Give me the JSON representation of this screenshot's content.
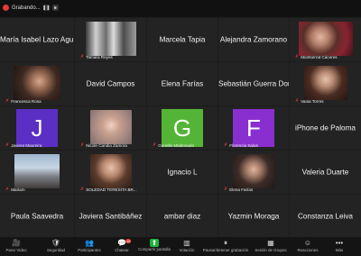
{
  "recording": {
    "label": "Grabando..."
  },
  "tiles": [
    {
      "name": "María Isabel Lazo Agu...",
      "label": ""
    },
    {
      "name": "",
      "label": "Tamara Reyes"
    },
    {
      "name": "Marcela Tapia",
      "label": ""
    },
    {
      "name": "Alejandra Zamorano",
      "label": ""
    },
    {
      "name": "",
      "label": "Montserrat Cáceres"
    },
    {
      "name": "",
      "label": "Francesca Rosa"
    },
    {
      "name": "David Campos",
      "label": ""
    },
    {
      "name": "Elena Farías",
      "label": ""
    },
    {
      "name": "Sebastián Guerra Don...",
      "label": ""
    },
    {
      "name": "",
      "label": "Vania Torres"
    },
    {
      "name": "",
      "initial": "J",
      "label": "Javiera Maureira"
    },
    {
      "name": "",
      "label": "Nicole Candia Zamora"
    },
    {
      "name": "",
      "initial": "G",
      "label": "Gunelle Maldonado"
    },
    {
      "name": "",
      "initial": "F",
      "label": "Florencia Salas"
    },
    {
      "name": "iPhone de Paloma",
      "label": ""
    },
    {
      "name": "",
      "label": "Mariam"
    },
    {
      "name": "",
      "label": "SOLEDAD TERESITA BR..."
    },
    {
      "name": "Ignacio L",
      "label": ""
    },
    {
      "name": "",
      "label": "Elena Farías"
    },
    {
      "name": "Valeria Duarte",
      "label": ""
    },
    {
      "name": "Paula Saavedra",
      "label": ""
    },
    {
      "name": "Javiera Santibáñez",
      "label": ""
    },
    {
      "name": "ambar diaz",
      "label": ""
    },
    {
      "name": "Yazmin Moraga",
      "label": ""
    },
    {
      "name": "Constanza Leiva",
      "label": ""
    }
  ],
  "toolbar": {
    "items": [
      {
        "label": "Parar Video",
        "icon": "🎥"
      },
      {
        "label": "Seguridad",
        "icon": "🛡"
      },
      {
        "label": "Participantes",
        "icon": "👥"
      },
      {
        "label": "Chatear",
        "icon": "💬",
        "badge": "19"
      },
      {
        "label": "Compartir pantalla",
        "icon": "⬆"
      },
      {
        "label": "Votación",
        "icon": "▥"
      },
      {
        "label": "Pausar/detener grabación",
        "icon": "⏸"
      },
      {
        "label": "Sesión de Grupos",
        "icon": "▦"
      },
      {
        "label": "Reacciones",
        "icon": "☺"
      },
      {
        "label": "Más",
        "icon": "•••"
      }
    ]
  },
  "colors": {
    "avatar_j": "#5b2fc4",
    "avatar_g": "#54b435",
    "avatar_f": "#8a2fcf",
    "share_green": "#1eb53a",
    "rec_red": "#e53935"
  }
}
